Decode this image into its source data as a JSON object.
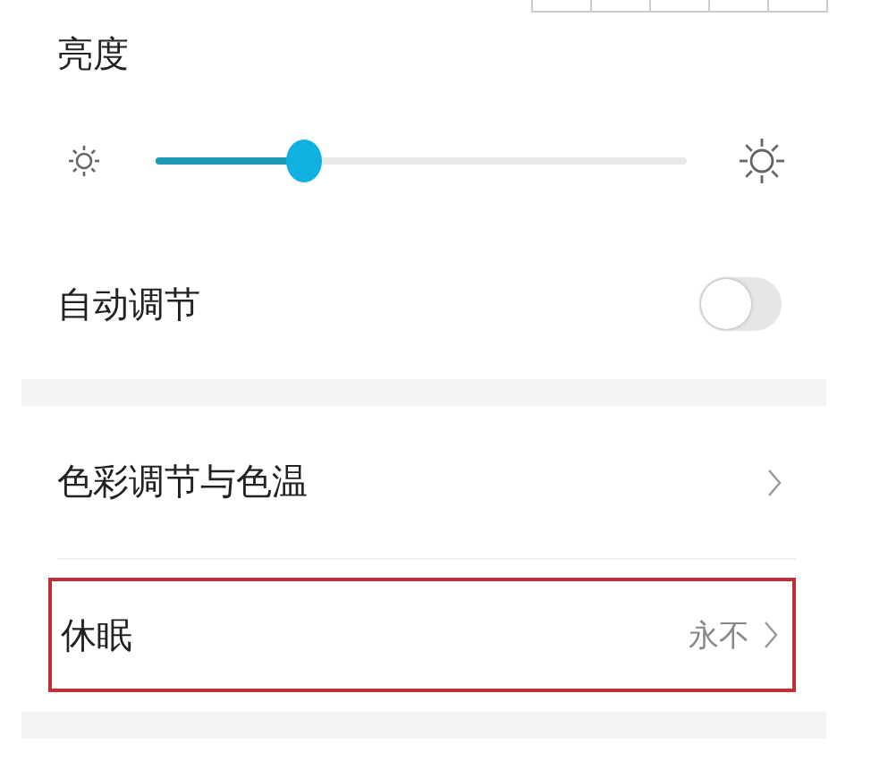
{
  "brightness": {
    "title": "亮度",
    "level": 0.28
  },
  "auto_adjust": {
    "label": "自动调节",
    "on": false
  },
  "rows": [
    {
      "label": "色彩调节与色温",
      "highlighted": false
    },
    {
      "label": "休眠",
      "value": "永不",
      "highlighted": true
    }
  ]
}
